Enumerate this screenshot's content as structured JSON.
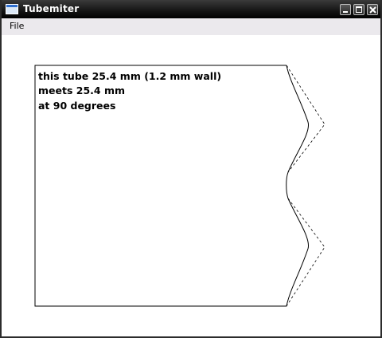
{
  "window": {
    "title": "Tubemiter",
    "icons": {
      "app": "app-window-icon",
      "minimize": "minimize-icon",
      "maximize": "maximize-icon",
      "close": "close-icon"
    }
  },
  "menubar": {
    "items": [
      {
        "label": "File"
      }
    ]
  },
  "template": {
    "lines": [
      "this tube 25.4 mm (1.2 mm wall)",
      "meets 25.4 mm",
      "at 90 degrees"
    ],
    "colors": {
      "outline": "#000000",
      "background": "#ffffff"
    }
  }
}
